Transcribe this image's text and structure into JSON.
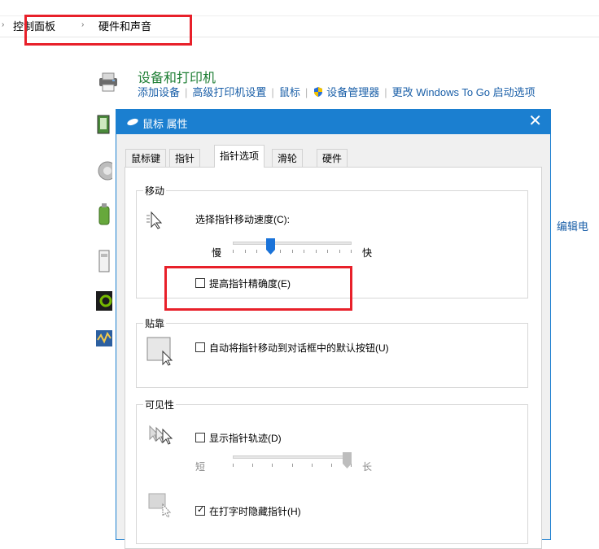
{
  "breadcrumb": {
    "items": [
      "控制面板",
      "硬件和声音"
    ],
    "separator": "›"
  },
  "category": {
    "title": "设备和打印机",
    "links": [
      "添加设备",
      "高级打印机设置",
      "鼠标",
      "设备管理器",
      "更改 Windows To Go 启动选项"
    ],
    "right_link": "编辑电"
  },
  "dialog": {
    "title": "鼠标 属性",
    "close_glyph": "✕",
    "tabs": [
      "鼠标键",
      "指针",
      "指针选项",
      "滑轮",
      "硬件"
    ],
    "active_tab": "指针选项",
    "motion": {
      "group_label": "移动",
      "speed_label": "选择指针移动速度(C):",
      "slow_label": "慢",
      "fast_label": "快",
      "speed_level": 0.3,
      "enhance_precision_label": "提高指针精确度(E)",
      "enhance_precision_checked": false
    },
    "snap_to": {
      "group_label": "贴靠",
      "snap_label": "自动将指针移动到对话框中的默认按钮(U)",
      "snap_checked": false
    },
    "visibility": {
      "group_label": "可见性",
      "trails_label": "显示指针轨迹(D)",
      "trails_checked": false,
      "short_label": "短",
      "long_label": "长",
      "trails_level": 1.0,
      "hide_typing_label": "在打字时隐藏指针(H)",
      "hide_typing_checked": true
    }
  },
  "colors": {
    "accent": "#1b7fd0",
    "link": "#1a5fa8",
    "category_title": "#1e7e34",
    "highlight_box": "#e8202a",
    "slider_thumb": "#1a73d9"
  }
}
